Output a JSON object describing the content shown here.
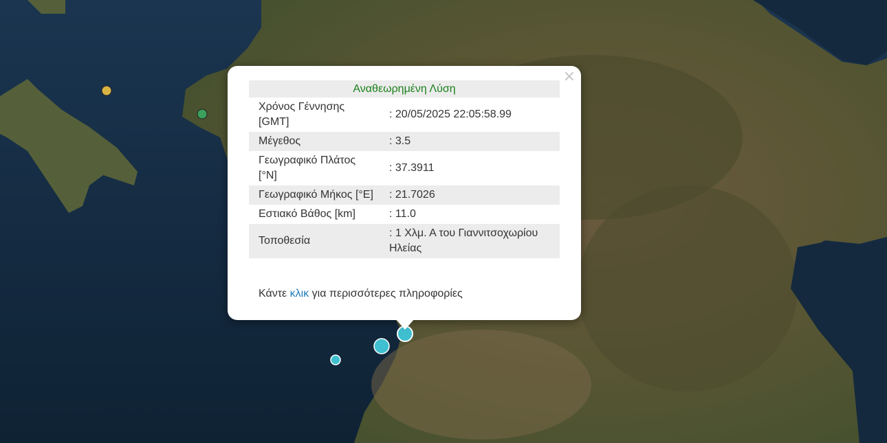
{
  "map": {
    "epicenter_marker_color": "#3fbfcf",
    "markers": [
      {
        "name": "marker-yellow",
        "color": "#d9b445"
      },
      {
        "name": "marker-green",
        "color": "#3aa05c"
      },
      {
        "name": "marker-epicenter",
        "color": "#3fbfcf"
      },
      {
        "name": "marker-cyan-large",
        "color": "#3fbfcf"
      },
      {
        "name": "marker-cyan-small",
        "color": "#3fbfcf"
      }
    ]
  },
  "popup": {
    "close_symbol": "×",
    "header": "Αναθεωρημένη Λύση",
    "header_color": "#1a7f1a",
    "rows": [
      {
        "label": "Χρόνος Γέννησης [GMT]",
        "value": ": 20/05/2025 22:05:58.99"
      },
      {
        "label": "Μέγεθος",
        "value": ": 3.5"
      },
      {
        "label": "Γεωγραφικό Πλάτος [°N]",
        "value": ": 37.3911"
      },
      {
        "label": "Γεωγραφικό Μήκος [°E]",
        "value": ": 21.7026"
      },
      {
        "label": "Εστιακό Βάθος [km]",
        "value": ": 11.0"
      },
      {
        "label": "Τοποθεσία",
        "value": ": 1 Χλμ. Α του Γιαννιτσοχωρίου Ηλείας"
      }
    ],
    "more_prefix": "Κάντε",
    "more_link": "κλικ",
    "more_suffix": "για περισσότερες πληροφορίες"
  }
}
